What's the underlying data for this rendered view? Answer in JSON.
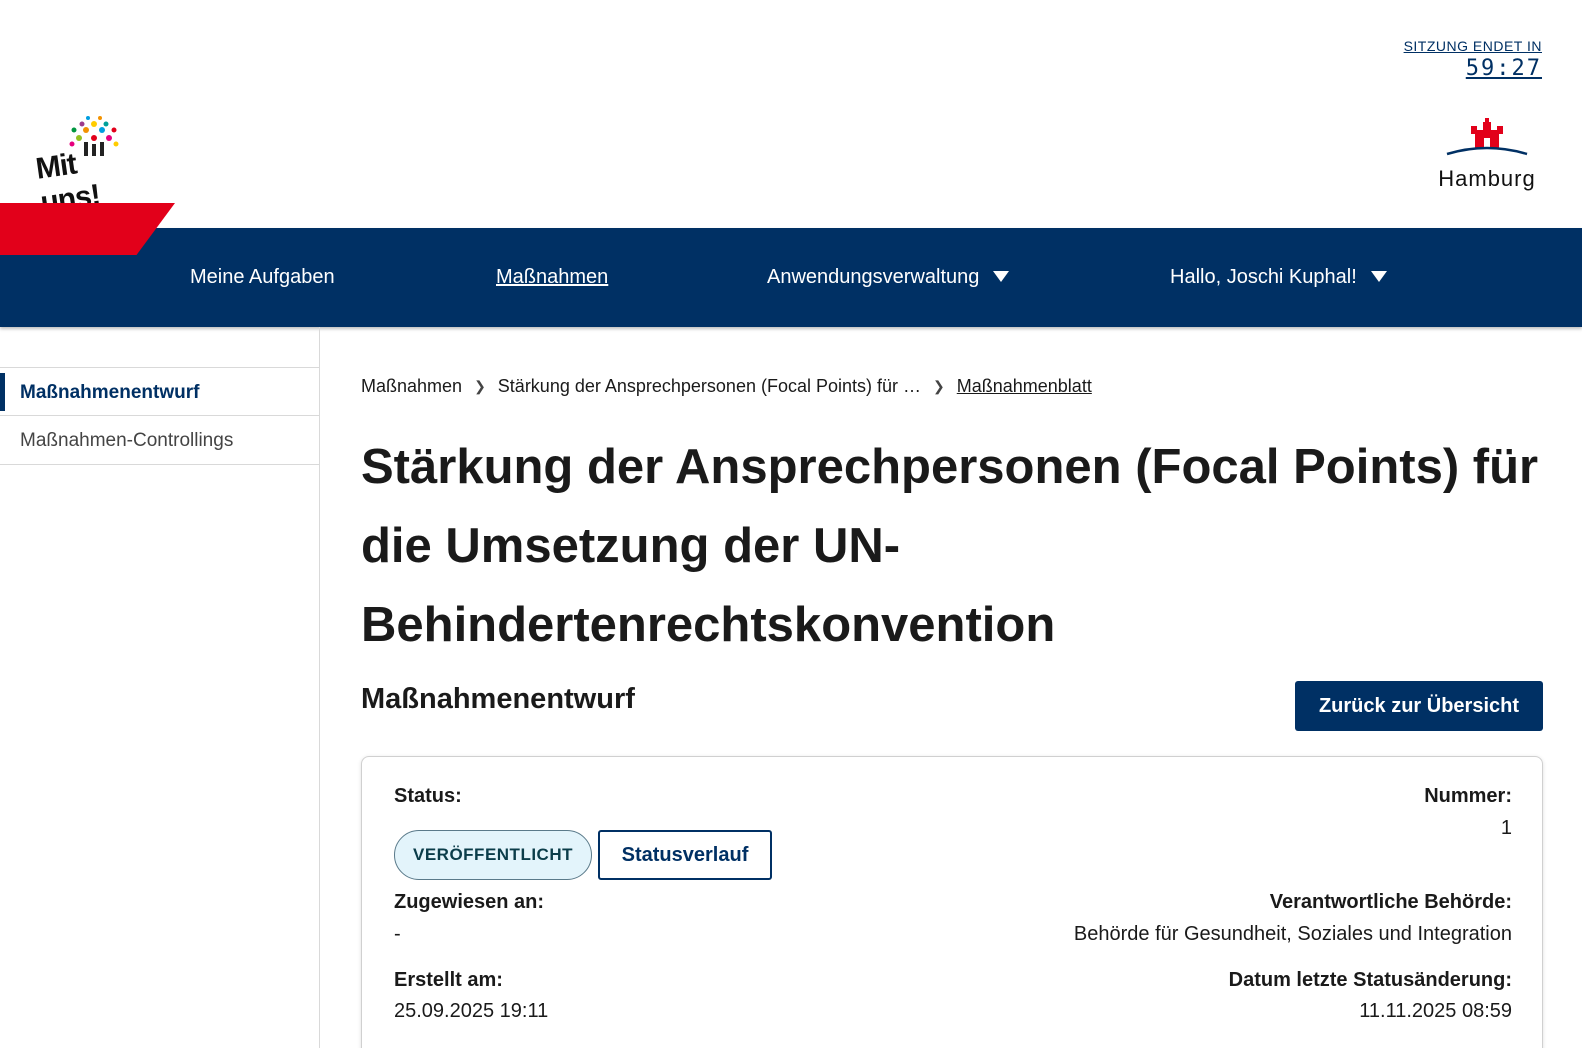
{
  "session": {
    "label": "SITZUNG ENDET IN",
    "time": "59:27"
  },
  "logos": {
    "left_text": "Mit uns!",
    "right_text": "Hamburg"
  },
  "nav": {
    "items": [
      {
        "label": "Meine Aufgaben",
        "active": false,
        "dropdown": false
      },
      {
        "label": "Maßnahmen",
        "active": true,
        "dropdown": false
      },
      {
        "label": "Anwendungsverwaltung",
        "active": false,
        "dropdown": true
      },
      {
        "label": "Hallo, Joschi Kuphal!",
        "active": false,
        "dropdown": true
      }
    ]
  },
  "sidebar": {
    "items": [
      {
        "label": "Maßnahmenentwurf",
        "active": true
      },
      {
        "label": "Maßnahmen-Controllings",
        "active": false
      }
    ]
  },
  "breadcrumb": {
    "items": [
      "Maßnahmen",
      "Stärkung der Ansprechpersonen (Focal Points) für …",
      "Maßnahmenblatt"
    ]
  },
  "page": {
    "title": "Stärkung der Ansprechpersonen (Focal Points) für die Umsetzung der UN-Behindertenrechtskonvention",
    "subtitle": "Maßnahmenentwurf",
    "back_button": "Zurück zur Übersicht"
  },
  "card": {
    "status_label": "Status:",
    "status_badge": "VERÖFFENTLICHT",
    "status_history_button": "Statusverlauf",
    "number_label": "Nummer:",
    "number_value": "1",
    "assigned_label": "Zugewiesen an:",
    "assigned_value": "-",
    "authority_label": "Verantwortliche Behörde:",
    "authority_value": "Behörde für Gesundheit, Soziales und Integration",
    "created_label": "Erstellt am:",
    "created_value": "25.09.2025 19:11",
    "status_change_label": "Datum letzte Statusänderung:",
    "status_change_value": "11.11.2025 08:59"
  },
  "colors": {
    "primary": "#003064",
    "accent_red": "#e2001a",
    "badge_bg": "#e3f4fb"
  }
}
